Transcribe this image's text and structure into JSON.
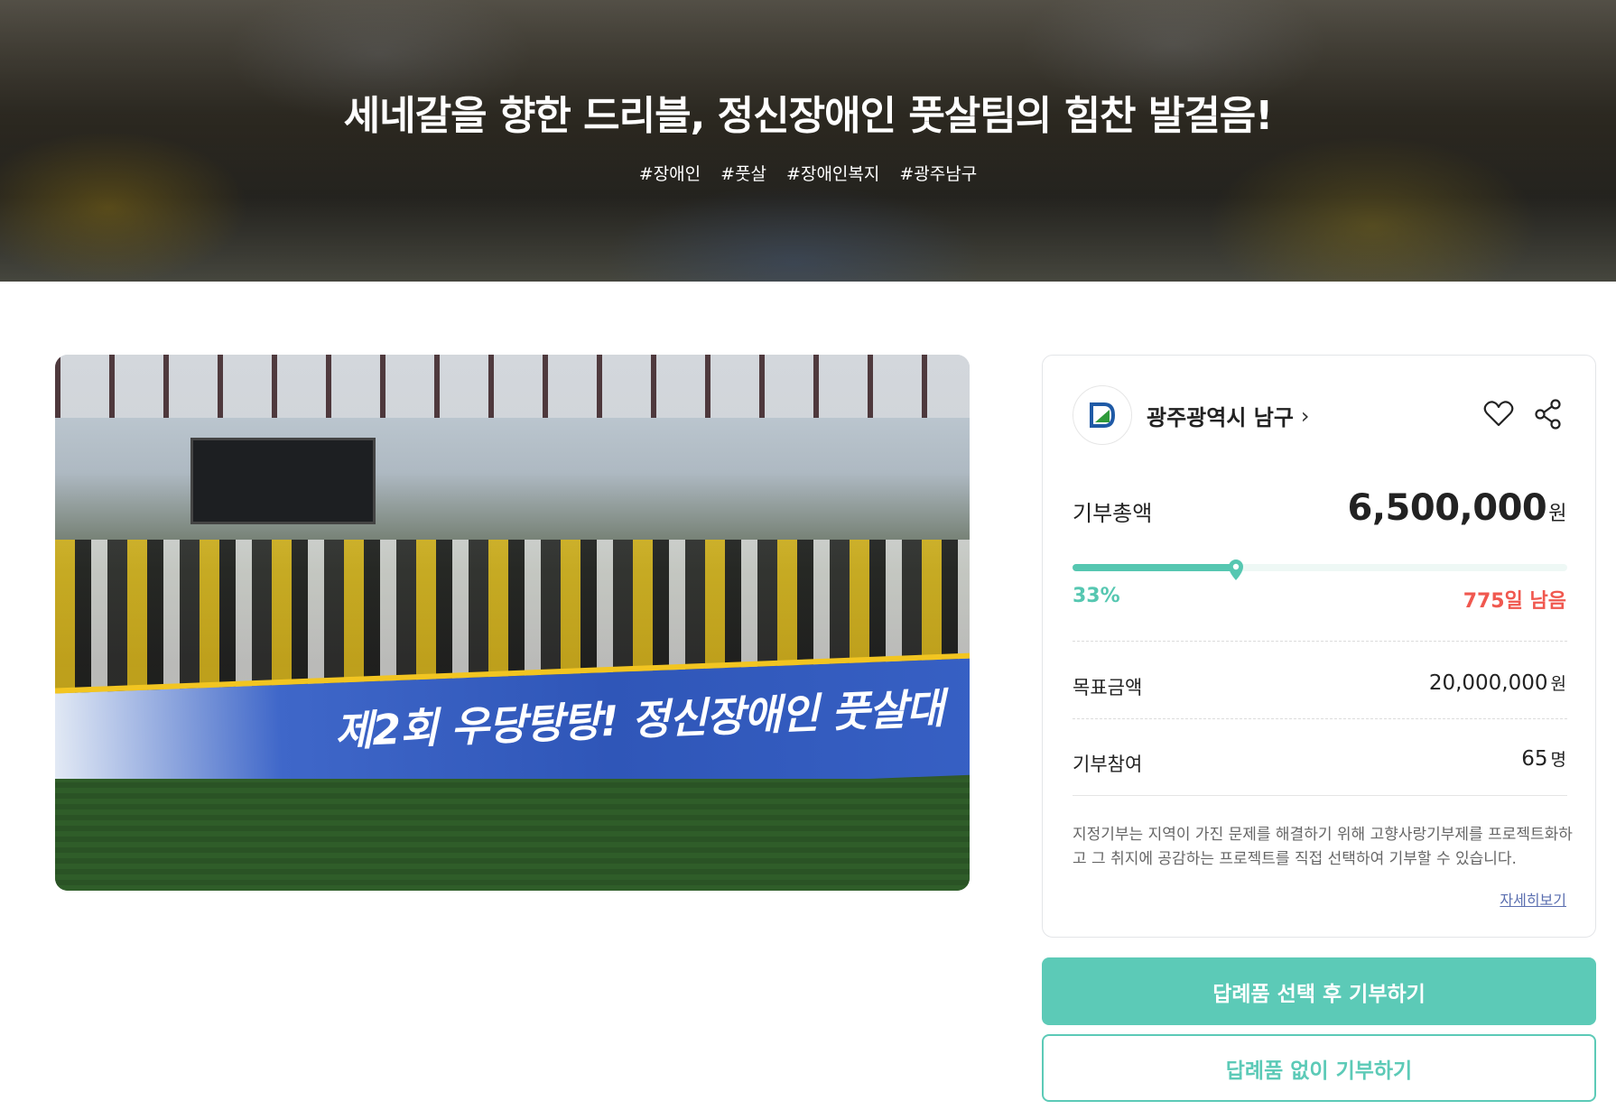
{
  "hero": {
    "title": "세네갈을 향한 드리블, 정신장애인 풋살팀의 힘찬 발걸음!",
    "tags": [
      "#장애인",
      "#풋살",
      "#장애인복지",
      "#광주남구"
    ]
  },
  "photo": {
    "banner_text": "제2회 우당탕탕! 정신장애인 풋살대"
  },
  "card": {
    "org_name": "광주광역시 남구",
    "total_label": "기부총액",
    "total_amount": "6,500,000",
    "total_unit": "원",
    "progress_percent": 33,
    "progress_label": "33%",
    "days_left": "775일 남음",
    "goal_label": "목표금액",
    "goal_amount": "20,000,000",
    "goal_unit": "원",
    "participants_label": "기부참여",
    "participants_count": "65",
    "participants_unit": "명",
    "description": "지정기부는 지역이 가진 문제를 해결하기 위해 고향사랑기부제를 프로젝트화하고 그 취지에 공감하는 프로젝트를 직접 선택하여 기부할 수 있습니다.",
    "more_link": "자세히보기"
  },
  "buttons": {
    "donate_with_gift": "답례품 선택 후 기부하기",
    "donate_without_gift": "답례품 없이 기부하기"
  },
  "colors": {
    "accent": "#5ccab7",
    "progress": "#56c7b1",
    "days_left": "#f0584f",
    "link": "#5b6fb0"
  }
}
